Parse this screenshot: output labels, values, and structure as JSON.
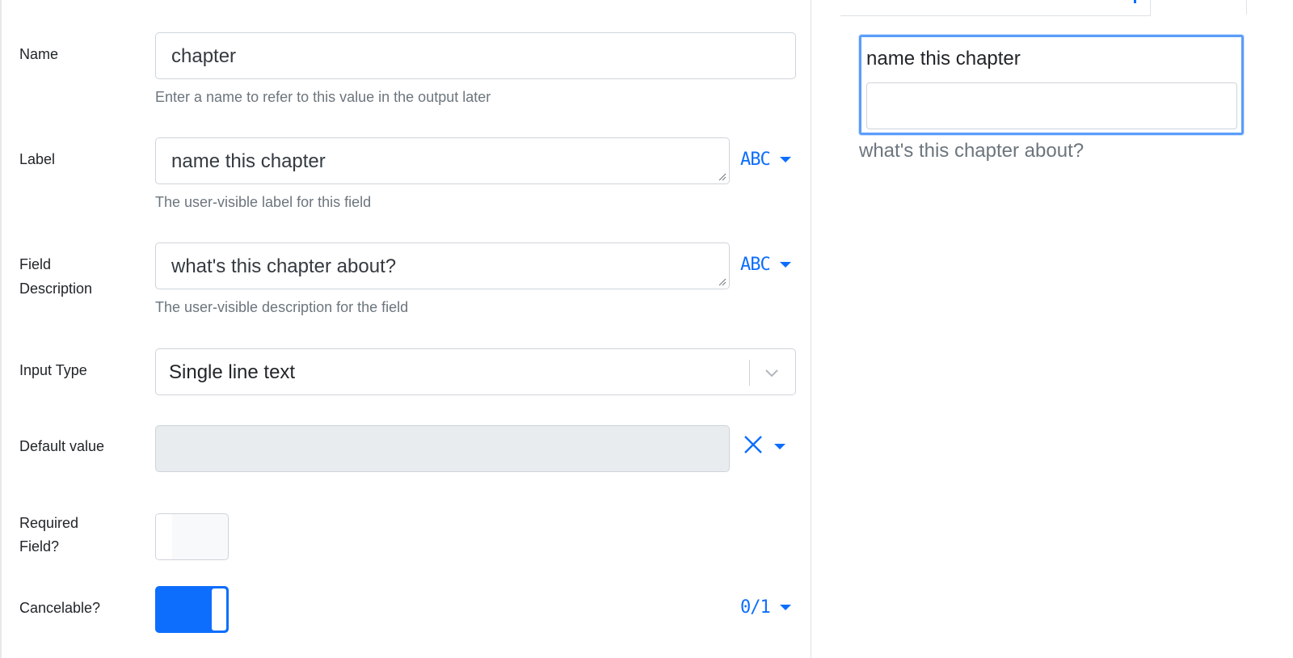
{
  "fields": {
    "name": {
      "label": "Name",
      "value": "chapter",
      "help": "Enter a name to refer to this value in the output later"
    },
    "label": {
      "label": "Label",
      "value": "name this chapter",
      "help": "The user-visible label for this field",
      "mode": "ABC"
    },
    "description": {
      "label_line1": "Field",
      "label_line2": "Description",
      "value": "what's this chapter about?",
      "help": "The user-visible description for the field",
      "mode": "ABC"
    },
    "input_type": {
      "label": "Input Type",
      "value": "Single line text"
    },
    "default_value": {
      "label": "Default value",
      "value": ""
    },
    "required": {
      "label_line1": "Required",
      "label_line2": "Field?",
      "checked": false
    },
    "cancelable": {
      "label": "Cancelable?",
      "checked": true,
      "mode": "0/1"
    }
  },
  "preview": {
    "label": "name this chapter",
    "description": "what's this chapter about?",
    "input_value": ""
  },
  "colors": {
    "accent": "#0d6efd",
    "focus_border": "#5b9df9",
    "muted_text": "#6c757d",
    "disabled_bg": "#e9ecef",
    "border": "#ced4da"
  },
  "icons": {
    "dropdown": "caret-down-icon",
    "select": "chevron-down-icon",
    "clear": "close-icon",
    "resize": "resize-grip-icon"
  }
}
